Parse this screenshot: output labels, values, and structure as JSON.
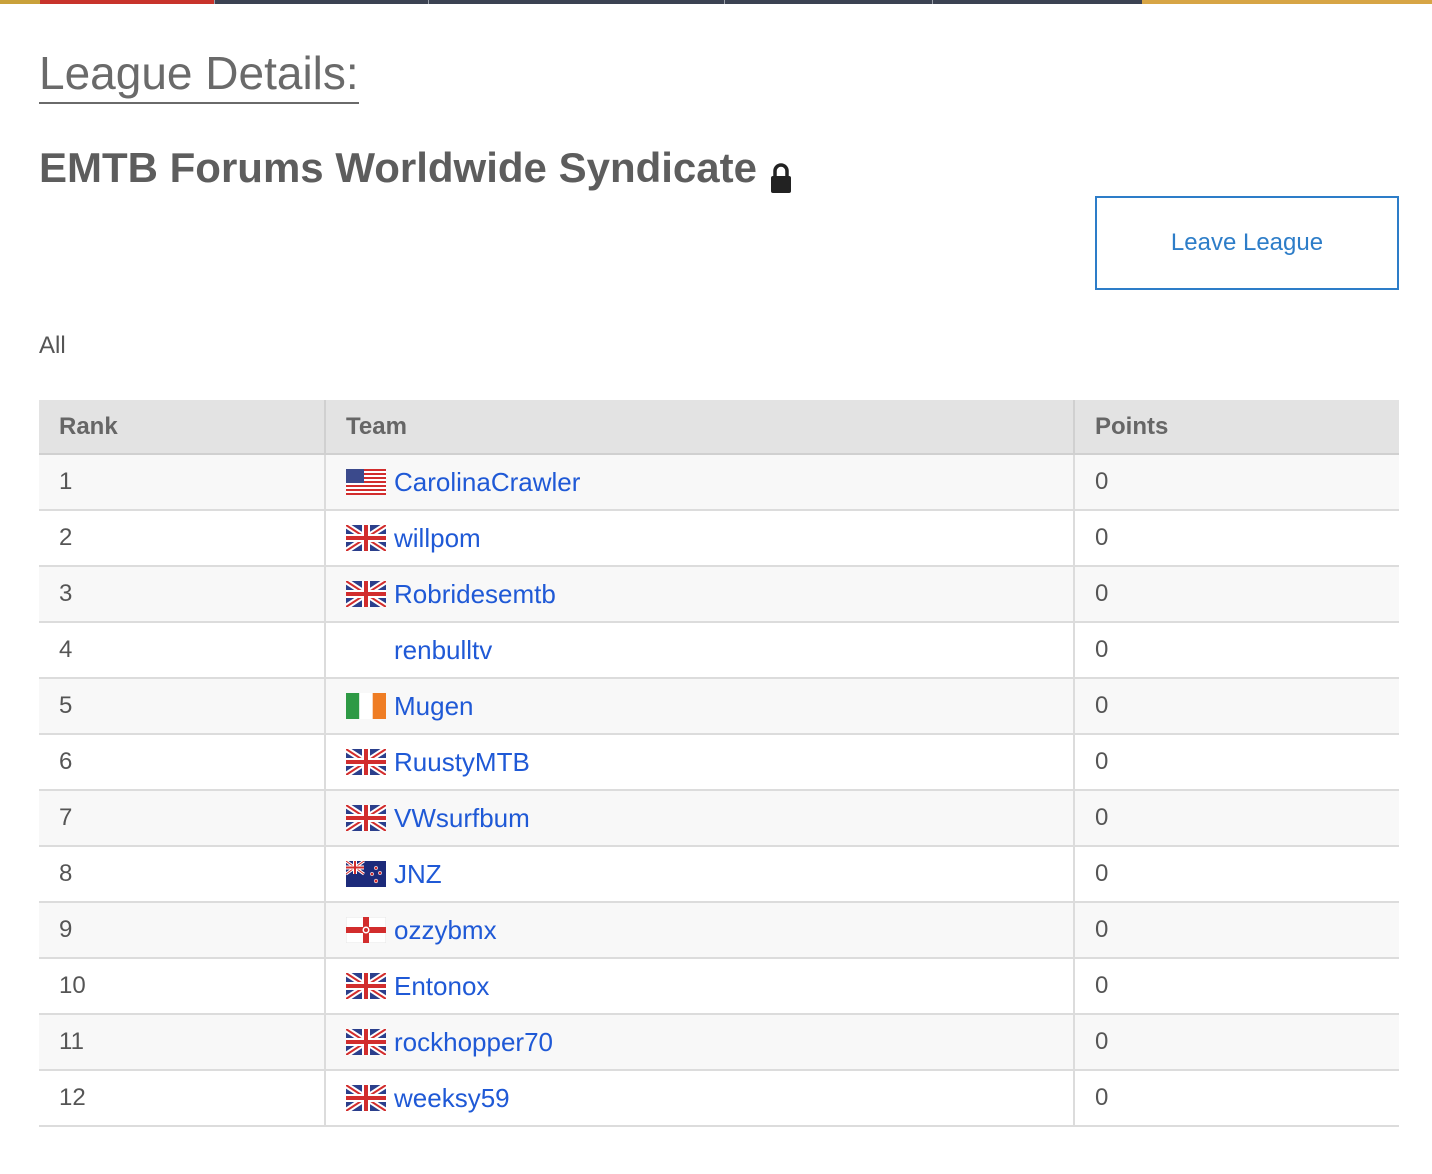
{
  "page": {
    "heading": "League Details:",
    "league_name": "EMTB Forums Worldwide Syndicate",
    "league_locked_icon": "lock-icon",
    "leave_button_label": "Leave League",
    "filter_label": "All"
  },
  "colors": {
    "link": "#1f59d6",
    "button_accent": "#2d7dc8",
    "header_bg": "#e3e3e3"
  },
  "table": {
    "headers": {
      "rank": "Rank",
      "team": "Team",
      "points": "Points"
    },
    "rows": [
      {
        "rank": "1",
        "team": "CarolinaCrawler",
        "flag": "us-flag-icon",
        "points": "0"
      },
      {
        "rank": "2",
        "team": "willpom",
        "flag": "uk-flag-icon",
        "points": "0"
      },
      {
        "rank": "3",
        "team": "Robridesemtb",
        "flag": "uk-flag-icon",
        "points": "0"
      },
      {
        "rank": "4",
        "team": "renbulltv",
        "flag": "",
        "points": "0"
      },
      {
        "rank": "5",
        "team": "Mugen",
        "flag": "ireland-flag-icon",
        "points": "0"
      },
      {
        "rank": "6",
        "team": "RuustyMTB",
        "flag": "uk-flag-icon",
        "points": "0"
      },
      {
        "rank": "7",
        "team": "VWsurfbum",
        "flag": "uk-flag-icon",
        "points": "0"
      },
      {
        "rank": "8",
        "team": "JNZ",
        "flag": "new-zealand-flag-icon",
        "points": "0"
      },
      {
        "rank": "9",
        "team": "ozzybmx",
        "flag": "northern-ireland-flag-icon",
        "points": "0"
      },
      {
        "rank": "10",
        "team": "Entonox",
        "flag": "uk-flag-icon",
        "points": "0"
      },
      {
        "rank": "11",
        "team": "rockhopper70",
        "flag": "uk-flag-icon",
        "points": "0"
      },
      {
        "rank": "12",
        "team": "weeksy59",
        "flag": "uk-flag-icon",
        "points": "0"
      }
    ]
  }
}
